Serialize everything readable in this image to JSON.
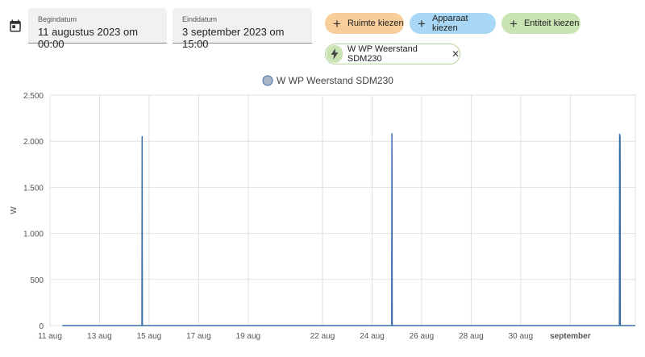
{
  "date_range": {
    "start_label": "Begindatum",
    "start_value": "11 augustus 2023 om 00:00",
    "end_label": "Einddatum",
    "end_value": "3 september 2023 om 15:00"
  },
  "target_picker": {
    "area_button": "Ruimte kiezen",
    "device_button": "Apparaat kiezen",
    "entity_button": "Entiteit kiezen",
    "selected_entity": "W WP Weerstand SDM230"
  },
  "colors": {
    "series": "#3a6fa8",
    "legend_marker": "#a9b7c6",
    "grid": "#e0e0e0"
  },
  "chart_data": {
    "type": "line",
    "ylabel": "W",
    "ylim": [
      0,
      2500
    ],
    "yticks": [
      0,
      500,
      1000,
      1500,
      2000,
      2500
    ],
    "ytick_labels": [
      "0",
      "500",
      "1.000",
      "1.500",
      "2.000",
      "2.500"
    ],
    "xlim": [
      "2023-08-11",
      "2023-09-03"
    ],
    "xticks": [
      {
        "date": "2023-08-11",
        "label": "11 aug",
        "bold": false
      },
      {
        "date": "2023-08-13",
        "label": "13 aug",
        "bold": false
      },
      {
        "date": "2023-08-15",
        "label": "15 aug",
        "bold": false
      },
      {
        "date": "2023-08-17",
        "label": "17 aug",
        "bold": false
      },
      {
        "date": "2023-08-19",
        "label": "19 aug",
        "bold": false
      },
      {
        "date": "2023-08-22",
        "label": "22 aug",
        "bold": false
      },
      {
        "date": "2023-08-24",
        "label": "24 aug",
        "bold": false
      },
      {
        "date": "2023-08-26",
        "label": "26 aug",
        "bold": false
      },
      {
        "date": "2023-08-28",
        "label": "28 aug",
        "bold": false
      },
      {
        "date": "2023-08-30",
        "label": "30 aug",
        "bold": false
      },
      {
        "date": "2023-09-01",
        "label": "september",
        "bold": true
      }
    ],
    "legend": "top-center",
    "grid": true,
    "series": [
      {
        "name": "W WP Weerstand SDM230",
        "points": [
          {
            "x": "2023-08-11 12:00",
            "y": 0
          },
          {
            "x": "2023-08-14 17:00",
            "y": 0
          },
          {
            "x": "2023-08-14 17:15",
            "y": 2050
          },
          {
            "x": "2023-08-14 17:30",
            "y": 0
          },
          {
            "x": "2023-08-24 19:00",
            "y": 0
          },
          {
            "x": "2023-08-24 19:15",
            "y": 2080
          },
          {
            "x": "2023-08-24 19:30",
            "y": 0
          },
          {
            "x": "2023-09-02 23:30",
            "y": 0
          },
          {
            "x": "2023-09-02 23:45",
            "y": 2075
          },
          {
            "x": "2023-09-03 00:15",
            "y": 2040
          },
          {
            "x": "2023-09-03 00:30",
            "y": 0
          },
          {
            "x": "2023-09-03 15:00",
            "y": 0
          }
        ]
      }
    ]
  }
}
